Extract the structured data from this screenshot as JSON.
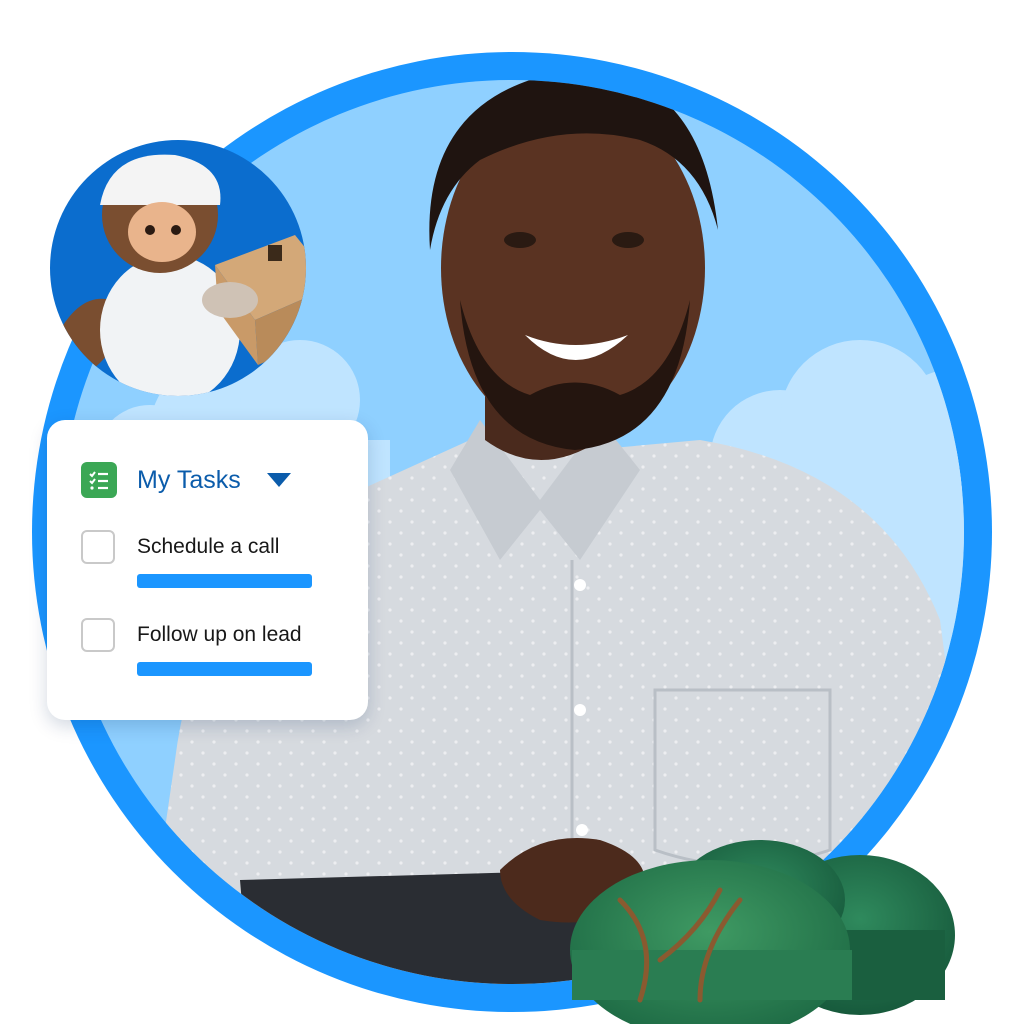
{
  "tasks_card": {
    "title": "My Tasks",
    "icon": "task-list-icon",
    "caret_icon": "caret-down-icon",
    "items": [
      {
        "label": "Schedule a call",
        "checked": false
      },
      {
        "label": "Follow up on lead",
        "checked": false
      }
    ]
  },
  "colors": {
    "ring_blue": "#1b96ff",
    "sky_blue": "#8ccfff",
    "accent_text": "#0b5cab",
    "task_icon_green": "#3ba755",
    "progress_bar": "#1b96ff"
  }
}
